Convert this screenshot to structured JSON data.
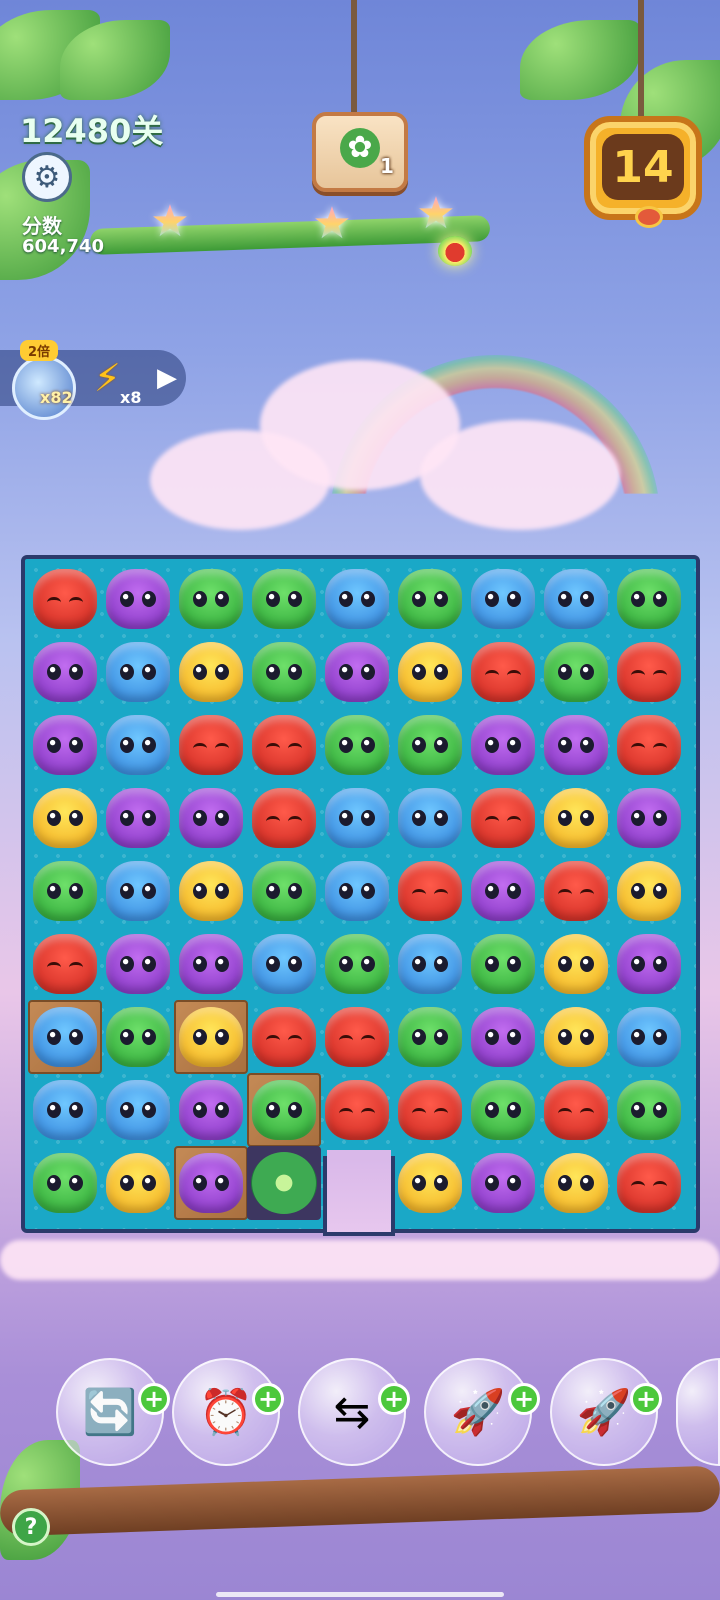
{
  "level": {
    "title": "12480关"
  },
  "score": {
    "label": "分数",
    "value": "604,740"
  },
  "goal": {
    "icon": "flower-icon",
    "count": "1"
  },
  "moves": {
    "value": "14"
  },
  "boosters": [
    {
      "icon": "bubble-booster-icon",
      "tag": "2倍",
      "count": "x82"
    },
    {
      "icon": "lightning-icon",
      "count": "x8"
    }
  ],
  "powerups": [
    {
      "icon": "shuffle-icon",
      "plus": "+"
    },
    {
      "icon": "clock-icon",
      "plus": "+"
    },
    {
      "icon": "swap-icon",
      "plus": "+"
    },
    {
      "icon": "rocket-horizontal-icon",
      "plus": "+"
    },
    {
      "icon": "rocket-vertical-icon",
      "plus": "+"
    }
  ],
  "help_label": "?",
  "board": [
    [
      "fox",
      "owl",
      "frog",
      "frog",
      "hippo",
      "frog",
      "hippo",
      "hippo",
      "frog"
    ],
    [
      "owl",
      "hippo",
      "chick",
      "frog",
      "owl",
      "chick",
      "fox",
      "frog",
      "fox"
    ],
    [
      "owl",
      "hippo",
      "fox",
      "fox",
      "frog",
      "frog",
      "owl",
      "owl",
      "fox"
    ],
    [
      "chick",
      "owl",
      "owl",
      "fox",
      "hippo",
      "hippo",
      "fox",
      "chick",
      "owl"
    ],
    [
      "frog",
      "hippo",
      "chick",
      "frog",
      "hippo",
      "fox",
      "owl",
      "fox",
      "chick"
    ],
    [
      "fox",
      "owl",
      "owl",
      "hippo",
      "frog",
      "hippo",
      "frog",
      "chick",
      "owl"
    ],
    [
      "hippo",
      "frog",
      "chick",
      "fox",
      "fox",
      "frog",
      "owl",
      "chick",
      "hippo"
    ],
    [
      "hippo",
      "hippo",
      "owl",
      "frog",
      "fox",
      "fox",
      "frog",
      "fox",
      "frog"
    ],
    [
      "frog",
      "chick",
      "owl",
      "lily",
      "",
      "chick",
      "owl",
      "chick",
      "fox"
    ]
  ],
  "crates": [
    [
      6,
      0
    ],
    [
      6,
      2
    ],
    [
      7,
      3
    ],
    [
      8,
      2
    ]
  ],
  "dark_cells": [
    [
      8,
      3
    ]
  ]
}
